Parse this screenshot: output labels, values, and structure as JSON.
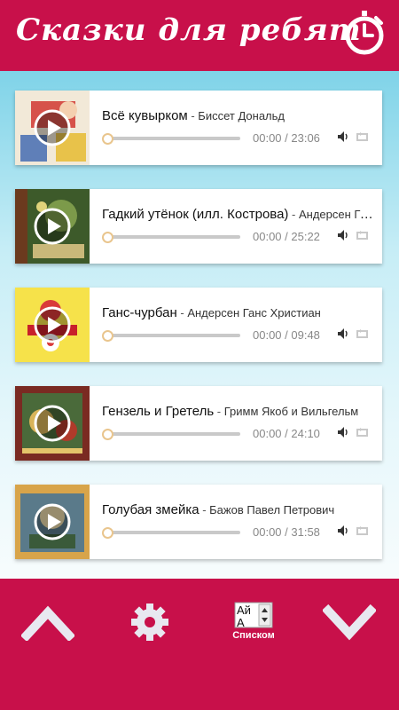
{
  "header": {
    "title": "Сказки для ребят",
    "timer_icon": "stopwatch-icon"
  },
  "colors": {
    "brand": "#c8104a",
    "thumb": "#e9c58d",
    "track": "#c9c9c9"
  },
  "tracks": [
    {
      "title": "Всё кувырком",
      "author": "Биссет Дональд",
      "time": "00:00 / 23:06",
      "progress": 0
    },
    {
      "title": "Гадкий утёнок (илл. Кострова)",
      "author": "Андерсен Ганс Христиан",
      "time": "00:00 / 25:22",
      "progress": 0
    },
    {
      "title": "Ганс-чурбан",
      "author": "Андерсен Ганс Христиан",
      "time": "00:00 / 09:48",
      "progress": 0
    },
    {
      "title": "Гензель и Гретель",
      "author": "Гримм Якоб и Вильгельм",
      "time": "00:00 / 24:10",
      "progress": 0
    },
    {
      "title": "Голубая змейка",
      "author": "Бажов Павел Петрович",
      "time": "00:00 / 31:58",
      "progress": 0
    }
  ],
  "footer": {
    "format_label": "Списком",
    "icons": [
      "chevron-up-icon",
      "gear-icon",
      "list-format-icon",
      "chevron-down-icon"
    ]
  }
}
